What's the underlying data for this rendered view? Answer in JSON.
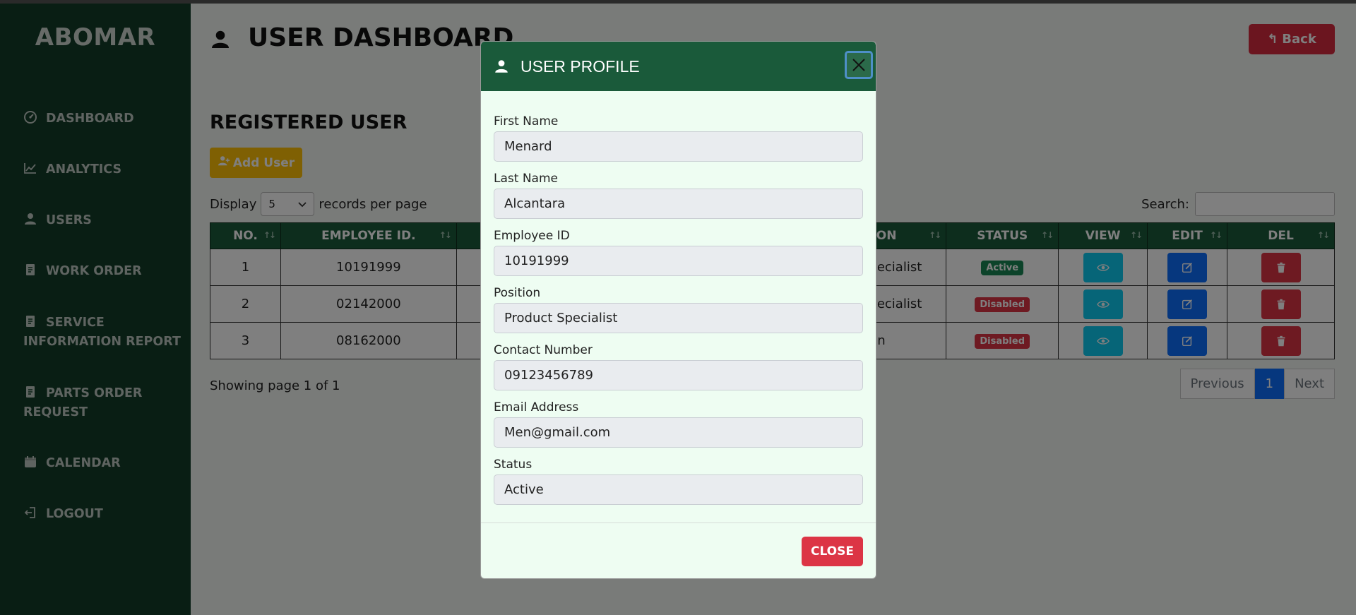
{
  "sidebar": {
    "brand": "ABOMAR",
    "items": [
      {
        "label": "DASHBOARD",
        "icon": "gauge-icon"
      },
      {
        "label": "ANALYTICS",
        "icon": "chart-line-icon"
      },
      {
        "label": "USERS",
        "icon": "user-icon"
      },
      {
        "label": "WORK ORDER",
        "icon": "document-icon"
      },
      {
        "label": "SERVICE INFORMATION REPORT",
        "icon": "document-icon"
      },
      {
        "label": "PARTS ORDER REQUEST",
        "icon": "document-icon"
      },
      {
        "label": "CALENDAR",
        "icon": "calendar-icon"
      },
      {
        "label": "LOGOUT",
        "icon": "logout-icon"
      }
    ]
  },
  "header": {
    "title": "USER DASHBOARD",
    "back_label": "Back"
  },
  "main": {
    "section_title": "REGISTERED USER",
    "add_user_label": "Add User",
    "display_label": "Display",
    "per_page_value": "5",
    "per_page_suffix": "records per page",
    "search_label": "Search:",
    "table": {
      "columns": [
        "NO.",
        "EMPLOYEE ID.",
        "",
        "SITION",
        "STATUS",
        "VIEW",
        "EDIT",
        "DEL"
      ],
      "rows": [
        {
          "no": "1",
          "employee_id": "10191999",
          "position": "ct Specialist",
          "status": "Active"
        },
        {
          "no": "2",
          "employee_id": "02142000",
          "position": "ct Specialist",
          "status": "Disabled"
        },
        {
          "no": "3",
          "employee_id": "08162000",
          "position": "Admin",
          "status": "Disabled"
        }
      ]
    },
    "showing_text": "Showing page 1 of 1",
    "pager": {
      "previous": "Previous",
      "current": "1",
      "next": "Next"
    }
  },
  "modal": {
    "title": "USER PROFILE",
    "fields": [
      {
        "label": "First Name",
        "value": "Menard"
      },
      {
        "label": "Last Name",
        "value": "Alcantara"
      },
      {
        "label": "Employee ID",
        "value": "10191999"
      },
      {
        "label": "Position",
        "value": "Product Specialist"
      },
      {
        "label": "Contact Number",
        "value": "09123456789"
      },
      {
        "label": "Email Address",
        "value": "Men@gmail.com"
      },
      {
        "label": "Status",
        "value": "Active"
      }
    ],
    "close_label": "CLOSE"
  },
  "colors": {
    "sidebar_bg": "#123d28",
    "header_green": "#1a5a3a",
    "danger": "#dc3545",
    "warning": "#ffc107",
    "info": "#0dcaf0",
    "primary": "#0d6efd",
    "success": "#198754"
  }
}
